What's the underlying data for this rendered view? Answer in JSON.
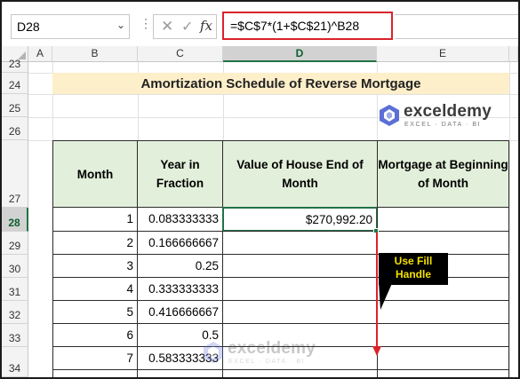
{
  "name_box": {
    "value": "D28"
  },
  "formula_bar": {
    "cancel_icon": "close-icon",
    "enter_icon": "check-icon",
    "fx_label": "fx",
    "formula": "=$C$7*(1+$C$21)^B28"
  },
  "columns": [
    "A",
    "B",
    "C",
    "D",
    "E"
  ],
  "selected_column": "D",
  "rows": [
    "23",
    "24",
    "25",
    "26",
    "27",
    "28",
    "29",
    "30",
    "31",
    "32",
    "33",
    "34"
  ],
  "selected_row": "28",
  "sheet": {
    "title": "Amortization Schedule of Reverse Mortgage",
    "headers": {
      "month": "Month",
      "year_fraction": "Year in Fraction",
      "house_value": "Value of House End of Month",
      "mortgage_begin": "Mortgage at Beginning of Month"
    },
    "data_rows": [
      {
        "month": "1",
        "year_fraction": "0.083333333",
        "house_value": "$270,992.20",
        "mortgage_begin": ""
      },
      {
        "month": "2",
        "year_fraction": "0.166666667",
        "house_value": "",
        "mortgage_begin": ""
      },
      {
        "month": "3",
        "year_fraction": "0.25",
        "house_value": "",
        "mortgage_begin": ""
      },
      {
        "month": "4",
        "year_fraction": "0.333333333",
        "house_value": "",
        "mortgage_begin": ""
      },
      {
        "month": "5",
        "year_fraction": "0.416666667",
        "house_value": "",
        "mortgage_begin": ""
      },
      {
        "month": "6",
        "year_fraction": "0.5",
        "house_value": "",
        "mortgage_begin": ""
      },
      {
        "month": "7",
        "year_fraction": "0.583333333",
        "house_value": "",
        "mortgage_begin": ""
      }
    ]
  },
  "watermark": {
    "name": "exceldemy",
    "tagline": "EXCEL · DATA · BI"
  },
  "callout": {
    "text": "Use Fill Handle"
  },
  "colors": {
    "header_fill": "#e2efda",
    "title_fill": "#fdefc9",
    "selection": "#217346",
    "formula_highlight": "#d9232a",
    "arrow": "#d9232a",
    "callout_bg": "#000000",
    "callout_text": "#f2e100",
    "logo_accent": "#5b6fd6"
  }
}
